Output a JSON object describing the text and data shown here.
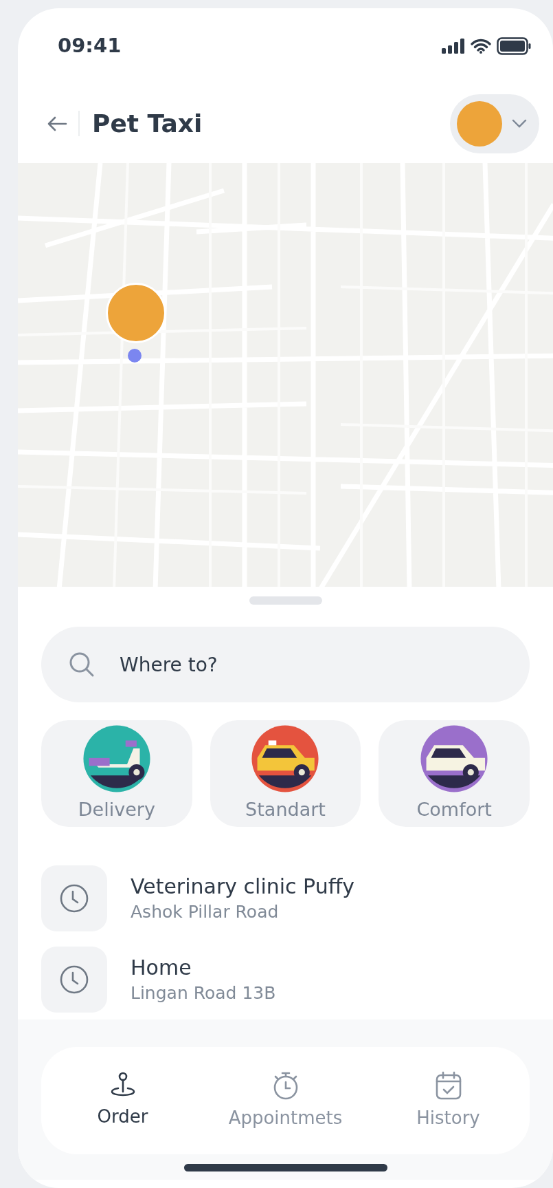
{
  "status_bar": {
    "time": "09:41"
  },
  "header": {
    "title": "Pet Taxi"
  },
  "search": {
    "placeholder": "Where to?"
  },
  "ride_types": [
    {
      "kind": "scooter",
      "label": "Delivery",
      "color": "#2bb3a8"
    },
    {
      "kind": "taxi",
      "label": "Standart",
      "color": "#e4533f"
    },
    {
      "kind": "car",
      "label": "Comfort",
      "color": "#9a6fcb"
    }
  ],
  "recent_places": [
    {
      "name": "Veterinary clinic Puffy",
      "address": "Ashok Pillar Road"
    },
    {
      "name": "Home",
      "address": "Lingan Road 13B"
    }
  ],
  "tabs": [
    {
      "kind": "pin",
      "label": "Order",
      "selected": true
    },
    {
      "kind": "timer",
      "label": "Appointmets",
      "selected": false
    },
    {
      "kind": "calendar",
      "label": "History",
      "selected": false
    }
  ]
}
